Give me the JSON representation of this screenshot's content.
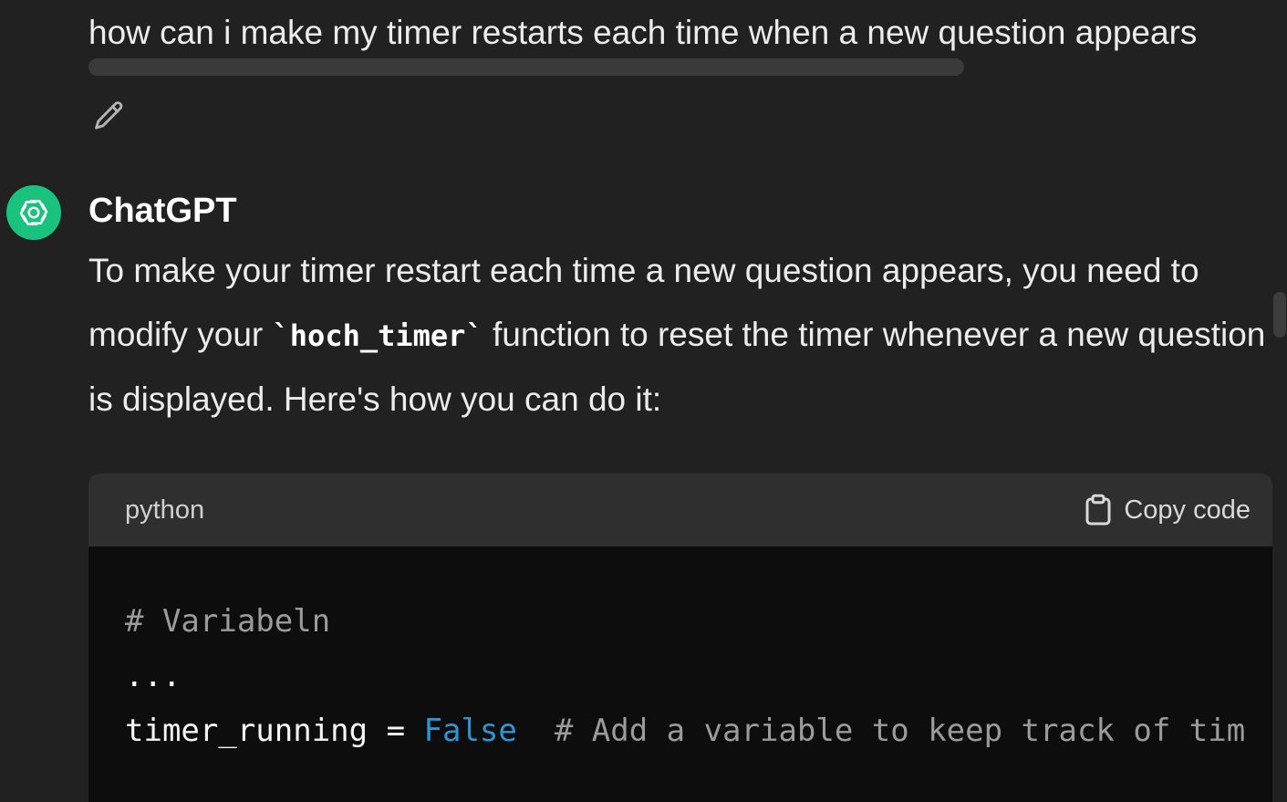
{
  "user_message": {
    "text": "how can i make my timer restarts each time when a new question appears"
  },
  "assistant": {
    "name": "ChatGPT",
    "intro_part1": "To make your timer restart each time a new question appears, you need to modify your ",
    "inline_code": "`hoch_timer`",
    "intro_part2": " function to reset the timer whenever a new question is displayed. Here's how you can do it:"
  },
  "code_block": {
    "language": "python",
    "copy_label": "Copy code",
    "lines": {
      "line1_comment": "# Variabeln",
      "line2": "...",
      "line3_code": "timer_running = ",
      "line3_keyword": "False",
      "line3_comment": "  # Add a variable to keep track of tim"
    }
  },
  "colors": {
    "background": "#212121",
    "avatar": "#19c37d",
    "code_bg": "#0d0d0d",
    "code_header_bg": "#2f2f2f",
    "keyword": "#2e95d3",
    "comment": "#9b9b9b"
  },
  "icons": {
    "edit": "pencil-icon",
    "avatar": "openai-logo-icon",
    "copy": "clipboard-icon"
  }
}
